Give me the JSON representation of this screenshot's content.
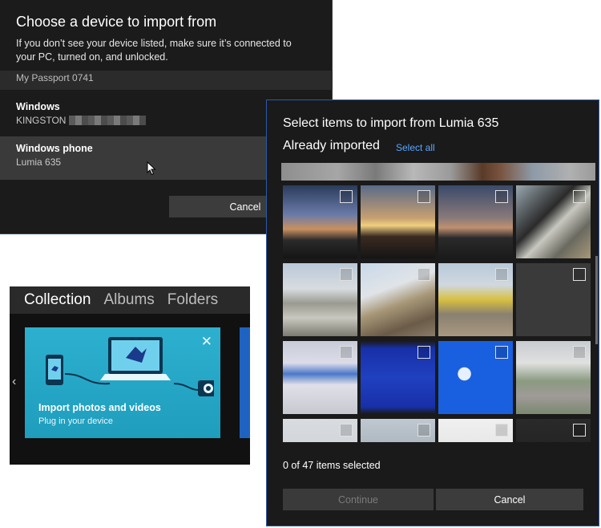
{
  "device_dialog": {
    "title": "Choose a device to import from",
    "description": "If you don’t see your device listed, make sure it’s connected to your PC, turned on, and unlocked.",
    "partial_item": "My Passport 0741",
    "devices": [
      {
        "name": "Windows",
        "subtitle": "KINGSTON"
      },
      {
        "name": "Windows phone",
        "subtitle": "Lumia 635"
      }
    ],
    "cancel_label": "Cancel"
  },
  "photos_app": {
    "tabs": [
      {
        "label": "Collection",
        "active": true
      },
      {
        "label": "Albums",
        "active": false
      },
      {
        "label": "Folders",
        "active": false
      }
    ],
    "tile": {
      "title": "Import photos and videos",
      "subtitle": "Plug in your device",
      "close_glyph": "✕"
    },
    "prev_glyph": "‹"
  },
  "select_dialog": {
    "title": "Select items to import from",
    "device": "Lumia 635",
    "section": "Already imported",
    "select_all": "Select all",
    "selection_status": "0 of 47 items selected",
    "continue_label": "Continue",
    "cancel_label": "Cancel",
    "thumbnails": [
      "sunset-field",
      "sunset-road",
      "dusk-lot",
      "bridge-underside",
      "concrete-deck",
      "bridge-ramp",
      "dump-truck",
      "dark-frame",
      "bios-screen-1",
      "bios-screen-2",
      "windows-setup",
      "blurred-tree",
      "pole",
      "construction",
      "white-panel",
      "dark-monitor"
    ]
  },
  "colors": {
    "accent": "#2db0cf",
    "link": "#5aa6ff",
    "dialog_border": "#2f57a8"
  }
}
